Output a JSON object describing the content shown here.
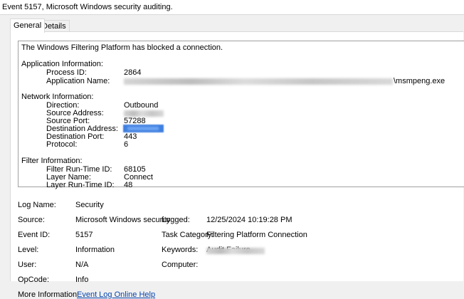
{
  "window": {
    "title": "Event 5157, Microsoft Windows security auditing."
  },
  "tabs": [
    {
      "label": "General"
    },
    {
      "label": "Details"
    }
  ],
  "description": {
    "headline": "The Windows Filtering Platform has blocked a connection.",
    "application": {
      "heading": "Application Information:",
      "process_id_label": "Process ID:",
      "process_id": "2864",
      "app_name_label": "Application Name:",
      "app_name_suffix": "\\msmpeng.exe"
    },
    "network": {
      "heading": "Network Information:",
      "direction_label": "Direction:",
      "direction": "Outbound",
      "source_address_label": "Source Address:",
      "source_port_label": "Source Port:",
      "source_port": "57288",
      "dest_address_label": "Destination Address:",
      "dest_port_label": "Destination Port:",
      "dest_port": "443",
      "protocol_label": "Protocol:",
      "protocol": "6"
    },
    "filter": {
      "heading": "Filter Information:",
      "runtime_id_label": "Filter Run-Time ID:",
      "runtime_id": "68105",
      "layer_name_label": "Layer Name:",
      "layer_name": "Connect",
      "layer_runtime_id_label": "Layer Run-Time ID:",
      "layer_runtime_id": "48"
    }
  },
  "details": {
    "log_name_label": "Log Name:",
    "log_name": "Security",
    "source_label": "Source:",
    "source": "Microsoft Windows security",
    "logged_label": "Logged:",
    "logged": "12/25/2024 10:19:28 PM",
    "event_id_label": "Event ID:",
    "event_id": "5157",
    "task_category_label": "Task Category:",
    "task_category": "Filtering Platform Connection",
    "level_label": "Level:",
    "level": "Information",
    "keywords_label": "Keywords:",
    "keywords": "Audit Failure",
    "user_label": "User:",
    "user": "N/A",
    "computer_label": "Computer:",
    "opcode_label": "OpCode:",
    "opcode": "Info",
    "more_info_label": "More Information:",
    "more_info_link": "Event Log Online Help"
  },
  "colors": {
    "link": "#0645ad",
    "selection": "#3f7fe0",
    "panel_border": "#a0a0a0"
  }
}
